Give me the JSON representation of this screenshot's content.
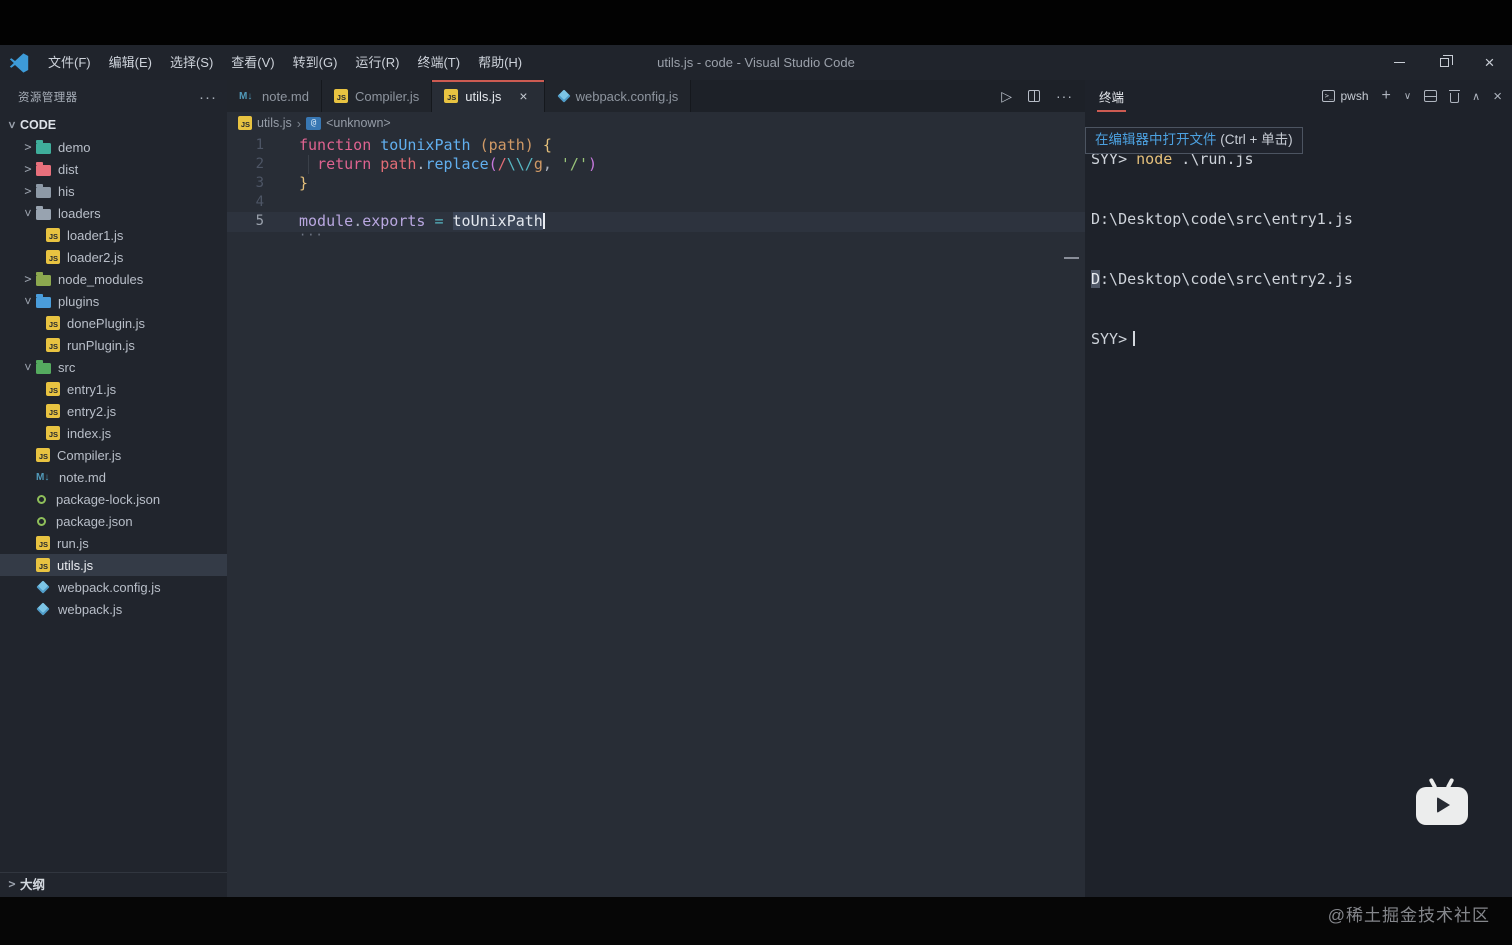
{
  "window": {
    "title": "utils.js - code - Visual Studio Code"
  },
  "menu": [
    "文件(F)",
    "编辑(E)",
    "选择(S)",
    "查看(V)",
    "转到(G)",
    "运行(R)",
    "终端(T)",
    "帮助(H)"
  ],
  "explorer": {
    "title": "资源管理器",
    "more": "···",
    "section": "CODE",
    "outline": "大纲",
    "tree": [
      {
        "label": "demo"
      },
      {
        "label": "dist"
      },
      {
        "label": "his"
      },
      {
        "label": "loaders"
      },
      {
        "label": "loader1.js"
      },
      {
        "label": "loader2.js"
      },
      {
        "label": "node_modules"
      },
      {
        "label": "plugins"
      },
      {
        "label": "donePlugin.js"
      },
      {
        "label": "runPlugin.js"
      },
      {
        "label": "src"
      },
      {
        "label": "entry1.js"
      },
      {
        "label": "entry2.js"
      },
      {
        "label": "index.js"
      },
      {
        "label": "Compiler.js"
      },
      {
        "label": "note.md"
      },
      {
        "label": "package-lock.json"
      },
      {
        "label": "package.json"
      },
      {
        "label": "run.js"
      },
      {
        "label": "utils.js"
      },
      {
        "label": "webpack.config.js"
      },
      {
        "label": "webpack.js"
      }
    ]
  },
  "tabs": [
    {
      "label": "note.md"
    },
    {
      "label": "Compiler.js"
    },
    {
      "label": "utils.js",
      "close": "×"
    },
    {
      "label": "webpack.config.js"
    }
  ],
  "breadcrumb": {
    "file": "utils.js",
    "sep": "›",
    "symbol": "<unknown>"
  },
  "editor": {
    "hint_dots": "···",
    "lines": [
      {
        "num": "1",
        "tokens": [
          {
            "t": "function "
          },
          {
            "t": "toUnixPath"
          },
          {
            "t": " "
          },
          {
            "t": "(path)"
          },
          {
            "t": " "
          },
          {
            "t": "{"
          }
        ]
      },
      {
        "num": "2",
        "tokens": [
          {
            "t": "  "
          },
          {
            "t": "return "
          },
          {
            "t": "path"
          },
          {
            "t": "."
          },
          {
            "t": "replace"
          },
          {
            "t": "("
          },
          {
            "t": "/"
          },
          {
            "t": "\\\\"
          },
          {
            "t": "/"
          },
          {
            "t": "g"
          },
          {
            "t": ", "
          },
          {
            "t": "'/'"
          },
          {
            "t": ")"
          }
        ]
      },
      {
        "num": "3",
        "tokens": [
          {
            "t": "}"
          }
        ]
      },
      {
        "num": "4",
        "tokens": []
      },
      {
        "num": "5",
        "tokens": [
          {
            "t": "module"
          },
          {
            "t": "."
          },
          {
            "t": "exports"
          },
          {
            "t": " "
          },
          {
            "t": "="
          },
          {
            "t": " "
          },
          {
            "t": "toUnixPath"
          }
        ]
      }
    ]
  },
  "terminal": {
    "title": "终端",
    "shell": "pwsh",
    "lines": {
      "l1_prompt": "SYY> ",
      "l1_cmd": "node",
      "l1_arg": " .\\run.js",
      "l2": "D:\\Desktop\\code\\src\\entry1.js",
      "l3_hl": "D",
      "l3_rest": ":\\Desktop\\code\\src\\entry2.js",
      "prompt": "SYY>"
    },
    "tooltip": {
      "link": "在编辑器中打开文件",
      "hint": " (Ctrl + 单击)"
    }
  },
  "watermark": {
    "text": "@稀土掘金技术社区"
  },
  "colors": {
    "accent_red": "#cd5b52",
    "link_blue": "#4ca1e0",
    "selection": "#3b4557",
    "js_yellow": "#e8c341",
    "webpack_blue": "#7cc5e6",
    "md_blue": "#519aba",
    "node_green": "#8fbf5a",
    "folder_demo": "#3fae9b",
    "folder_dist": "#e8707c",
    "folder_neutral": "#8d99a6",
    "folder_node": "#8ca84f",
    "folder_plugins": "#4a9ddb",
    "folder_src": "#55ab5f"
  }
}
